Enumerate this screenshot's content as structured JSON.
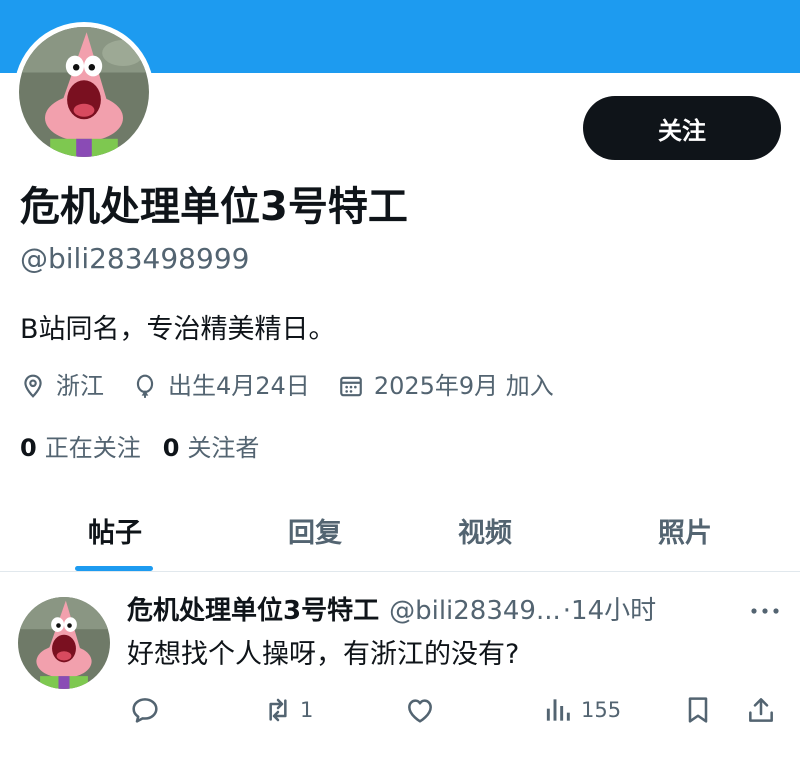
{
  "profile": {
    "display_name": "危机处理单位3号特工",
    "handle": "@bili283498999",
    "bio": "B站同名，专治精美精日。",
    "follow_label": "关注",
    "location": "浙江",
    "birthday": "出生4月24日",
    "joined": "2025年9月 加入",
    "following_count": "0",
    "following_label": "正在关注",
    "followers_count": "0",
    "followers_label": "关注者"
  },
  "tabs": [
    {
      "label": "帖子",
      "active": true
    },
    {
      "label": "回复",
      "active": false
    },
    {
      "label": "视频",
      "active": false
    },
    {
      "label": "照片",
      "active": false
    }
  ],
  "post": {
    "author_name": "危机处理单位3号特工",
    "author_handle": "@bili28349...",
    "time": "·14小时",
    "text": "好想找个人操呀，有浙江的没有?",
    "reposts": "1",
    "views": "155",
    "icons": [
      "reply-icon",
      "repost-icon",
      "like-icon",
      "views-icon",
      "bookmark-icon",
      "share-icon"
    ]
  },
  "colors": {
    "banner": "#1d9bf0",
    "accent": "#1d9bf0",
    "text": "#0f1419",
    "secondary": "#536471",
    "button": "#0f1419"
  }
}
